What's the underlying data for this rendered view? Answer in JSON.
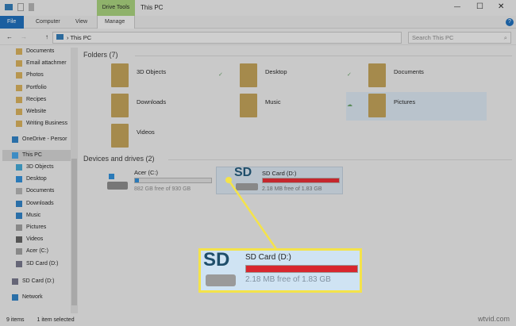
{
  "window": {
    "title": "This PC",
    "context_tab": "Drive Tools",
    "minimize": "—",
    "maximize": "☐",
    "close": "✕",
    "help": "?"
  },
  "ribbon": {
    "tabs": [
      "File",
      "Computer",
      "View",
      "Manage"
    ]
  },
  "address": {
    "back": "←",
    "forward": "→",
    "up": "↑",
    "path": "This PC",
    "search_placeholder": "Search This PC"
  },
  "sidebar": {
    "quick": [
      "Documents",
      "Email attachmer",
      "Photos",
      "Portfolio",
      "Recipes",
      "Website",
      "Writing Business"
    ],
    "onedrive": "OneDrive - Persor",
    "thispc": "This PC",
    "pc_items": [
      "3D Objects",
      "Desktop",
      "Documents",
      "Downloads",
      "Music",
      "Pictures",
      "Videos",
      "Acer (C:)",
      "SD Card (D:)"
    ],
    "sdcard": "SD Card (D:)",
    "network": "Network"
  },
  "main": {
    "folders_header": "Folders (7)",
    "folders": [
      "3D Objects",
      "Desktop",
      "Documents",
      "Downloads",
      "Music",
      "Pictures",
      "Videos"
    ],
    "drives_header": "Devices and drives (2)",
    "drives": [
      {
        "name": "Acer (C:)",
        "free": "882 GB free of 930 GB",
        "used_fraction": 0.05,
        "color": "#2a7ab8"
      },
      {
        "name": "SD Card (D:)",
        "free": "2.18 MB free of 1.83 GB",
        "used_fraction": 0.999,
        "color": "#c4272e",
        "sd": "SD"
      }
    ]
  },
  "status": {
    "items": "9 items",
    "selected": "1 item selected"
  },
  "callout": {
    "sd": "SD",
    "name": "SD Card (D:)",
    "free": "2.18 MB free of 1.83 GB",
    "used_fraction": 0.999
  },
  "watermark": "wtvid.com",
  "colors": {
    "highlight": "#f4e34a",
    "full_drive": "#c4272e",
    "file_tab": "#1b5fa0",
    "drive_tools": "#8fb26b"
  }
}
